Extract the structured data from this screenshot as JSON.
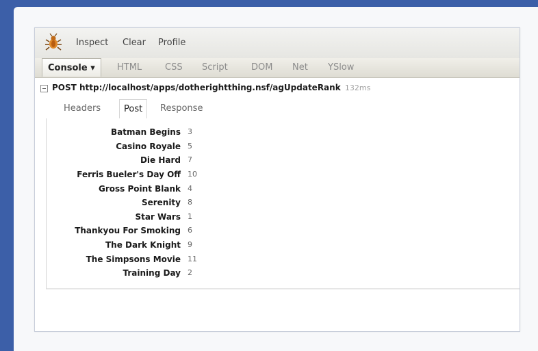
{
  "toolbar": {
    "inspect_label": "Inspect",
    "clear_label": "Clear",
    "profile_label": "Profile"
  },
  "tabs": [
    {
      "label": "Console ▾",
      "active": true
    },
    {
      "label": "HTML"
    },
    {
      "label": "CSS"
    },
    {
      "label": "Script"
    },
    {
      "label": "DOM"
    },
    {
      "label": "Net"
    },
    {
      "label": "YSlow"
    }
  ],
  "request": {
    "method_url": "POST http://localhost/apps/dotherightthing.nsf/agUpdateRank",
    "time": "132ms"
  },
  "subtabs": [
    {
      "label": "Headers"
    },
    {
      "label": "Post",
      "active": true
    },
    {
      "label": "Response"
    }
  ],
  "post_params": [
    {
      "name": "Batman Begins",
      "value": "3"
    },
    {
      "name": "Casino Royale",
      "value": "5"
    },
    {
      "name": "Die Hard",
      "value": "7"
    },
    {
      "name": "Ferris Bueler's Day Off",
      "value": "10"
    },
    {
      "name": "Gross Point Blank",
      "value": "4"
    },
    {
      "name": "Serenity",
      "value": "8"
    },
    {
      "name": "Star Wars",
      "value": "1"
    },
    {
      "name": "Thankyou For Smoking",
      "value": "6"
    },
    {
      "name": "The Dark Knight",
      "value": "9"
    },
    {
      "name": "The Simpsons Movie",
      "value": "11"
    },
    {
      "name": "Training Day",
      "value": "2"
    }
  ],
  "icons": {
    "firebug": "firebug-bug-icon",
    "toggle": "collapse-toggle-icon"
  },
  "colors": {
    "desktop_bg": "#3c5fa8",
    "panel_border": "#c9cfdb"
  }
}
